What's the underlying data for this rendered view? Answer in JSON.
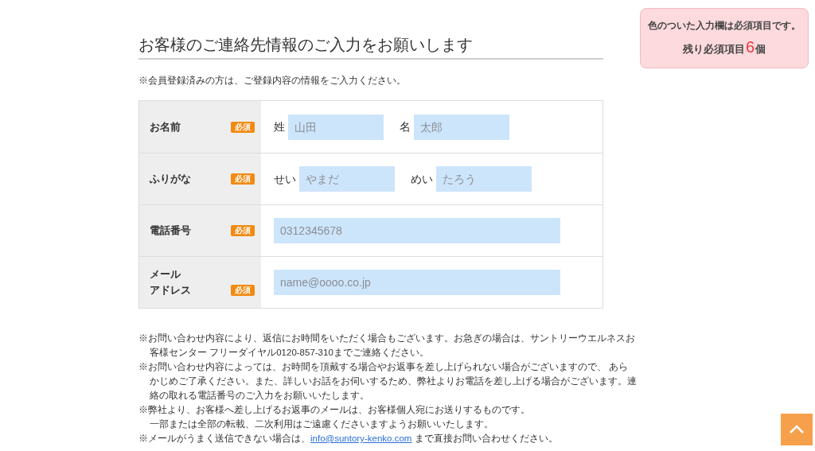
{
  "heading": "お客様のご連絡先情報のご入力をお願いします",
  "intro": "※会員登録済みの方は、ご登録内容の情報をご入力ください。",
  "notice": {
    "line1": "色のついた入力欄は必須項目です。",
    "prefix": "残り必須項目",
    "count": "6",
    "suffix": "個"
  },
  "rows": [
    {
      "kind": "pair",
      "label": [
        "お名前"
      ],
      "badge": "必須",
      "fields": [
        {
          "label": "姓",
          "placeholder": "山田"
        },
        {
          "label": "名",
          "placeholder": "太郎"
        }
      ]
    },
    {
      "kind": "pair",
      "label": [
        "ふりがな"
      ],
      "badge": "必須",
      "fields": [
        {
          "label": "せい",
          "placeholder": "やまだ"
        },
        {
          "label": "めい",
          "placeholder": "たろう"
        }
      ]
    },
    {
      "kind": "single",
      "label": [
        "電話番号"
      ],
      "badge": "必須",
      "placeholder": "0312345678"
    },
    {
      "kind": "single",
      "label": [
        "メール",
        "アドレス"
      ],
      "badge": "必須",
      "placeholder": "name@oooo.co.jp"
    }
  ],
  "notes": [
    {
      "lines": [
        "※お問い合わせ内容により、返信にお時間をいただく場合もございます。お急ぎの場合は、サントリーウエルネスお",
        "客様センター フリーダイヤル0120-857-310までご連絡ください。"
      ]
    },
    {
      "lines": [
        "※お問い合わせ内容によっては、お時間を頂戴する場合やお返事を差し上げられない場合がございますので、 あら",
        "かじめご了承ください。また、詳しいお話をお伺いするため、弊社よりお電話を差し上げる場合がございます。連",
        "絡の取れる電話番号のご入力をお願いいたします。"
      ]
    },
    {
      "lines": [
        "※弊社より、お客様へ差し上げるお返事のメールは、お客様個人宛にお送りするものです。",
        "一部または全部の転載、二次利用はご遠慮くださいますようお願いいたします。"
      ]
    },
    {
      "before": "※メールがうまく送信できない場合は、",
      "link": "info@suntory-kenko.com",
      "after": " まで直接お問い合わせください。"
    }
  ]
}
